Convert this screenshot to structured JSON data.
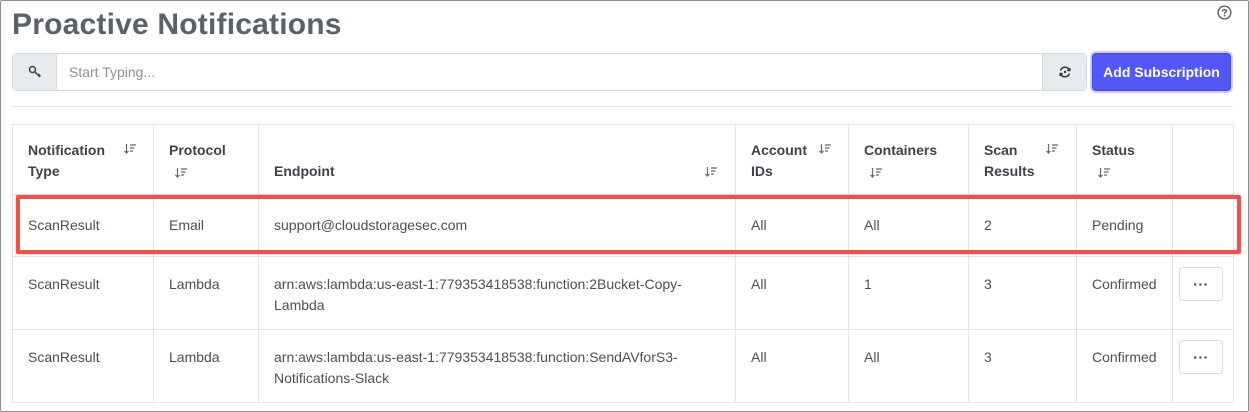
{
  "page": {
    "title": "Proactive Notifications"
  },
  "icons": {
    "help": "question-circle-icon",
    "search": "key-icon",
    "refresh": "refresh-icon",
    "sort": "sort-icon",
    "more": "ellipsis-icon"
  },
  "search": {
    "placeholder": "Start Typing...",
    "value": ""
  },
  "toolbar": {
    "add_label": "Add Subscription"
  },
  "colors": {
    "accent": "#5257f5",
    "highlight": "#e8534a"
  },
  "table": {
    "columns": [
      {
        "label": "Notification Type"
      },
      {
        "label": "Protocol"
      },
      {
        "label": "Endpoint"
      },
      {
        "label": "Account IDs"
      },
      {
        "label": "Containers"
      },
      {
        "label": "Scan Results"
      },
      {
        "label": "Status"
      },
      {
        "label": ""
      }
    ],
    "rows": [
      {
        "type": "ScanResult",
        "protocol": "Email",
        "endpoint": "support@cloudstoragesec.com",
        "account_ids": "All",
        "containers": "All",
        "scan_results": "2",
        "status": "Pending",
        "has_menu": false
      },
      {
        "type": "ScanResult",
        "protocol": "Lambda",
        "endpoint": "arn:aws:lambda:us-east-1:779353418538:function:2Bucket-Copy-Lambda",
        "account_ids": "All",
        "containers": "1",
        "scan_results": "3",
        "status": "Confirmed",
        "has_menu": true,
        "menu_label": "···"
      },
      {
        "type": "ScanResult",
        "protocol": "Lambda",
        "endpoint": "arn:aws:lambda:us-east-1:779353418538:function:SendAVforS3-Notifications-Slack",
        "account_ids": "All",
        "containers": "All",
        "scan_results": "3",
        "status": "Confirmed",
        "has_menu": true,
        "menu_label": "···"
      }
    ]
  }
}
